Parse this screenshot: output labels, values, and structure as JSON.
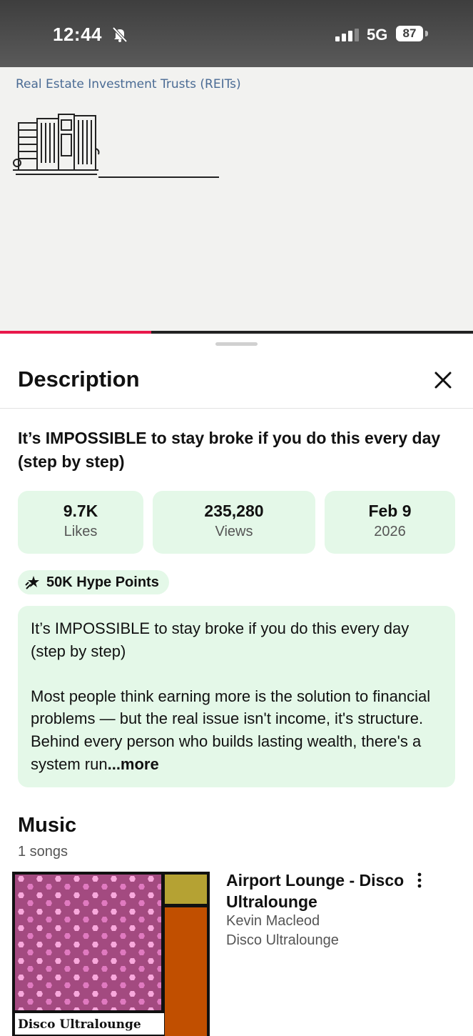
{
  "status_bar": {
    "time": "12:44",
    "network": "5G",
    "battery": "87"
  },
  "video": {
    "caption": "Real Estate Investment Trusts (REITs)",
    "progress": 0.32
  },
  "sheet": {
    "title": "Description",
    "video_title": "It’s IMPOSSIBLE to stay broke if you do this every day (step by step)",
    "stats": [
      {
        "value": "9.7K",
        "label": "Likes"
      },
      {
        "value": "235,280",
        "label": "Views"
      },
      {
        "value": "Feb 9",
        "label": "2026"
      }
    ],
    "hype": "50K Hype Points",
    "description": {
      "p1": "It’s IMPOSSIBLE to stay broke if you do this every day (step by step)",
      "p2": "Most people think earning more is the solution to financial problems — but the real issue isn't income, it's structure. Behind every person who builds lasting wealth, there's a system run",
      "more": "...more"
    },
    "music": {
      "title": "Music",
      "count": "1 songs",
      "song": {
        "title": "Airport Lounge - Disco Ultralounge",
        "artist": "Kevin Macleod",
        "album": "Disco Ultralounge",
        "album_art_label": "Disco Ultralounge"
      }
    }
  },
  "colors": {
    "accent_bg": "#e4f8e8",
    "progress": "#e8184b",
    "album_pink": "#a34a80",
    "album_olive": "#b5a233",
    "album_orange": "#c14f00"
  }
}
